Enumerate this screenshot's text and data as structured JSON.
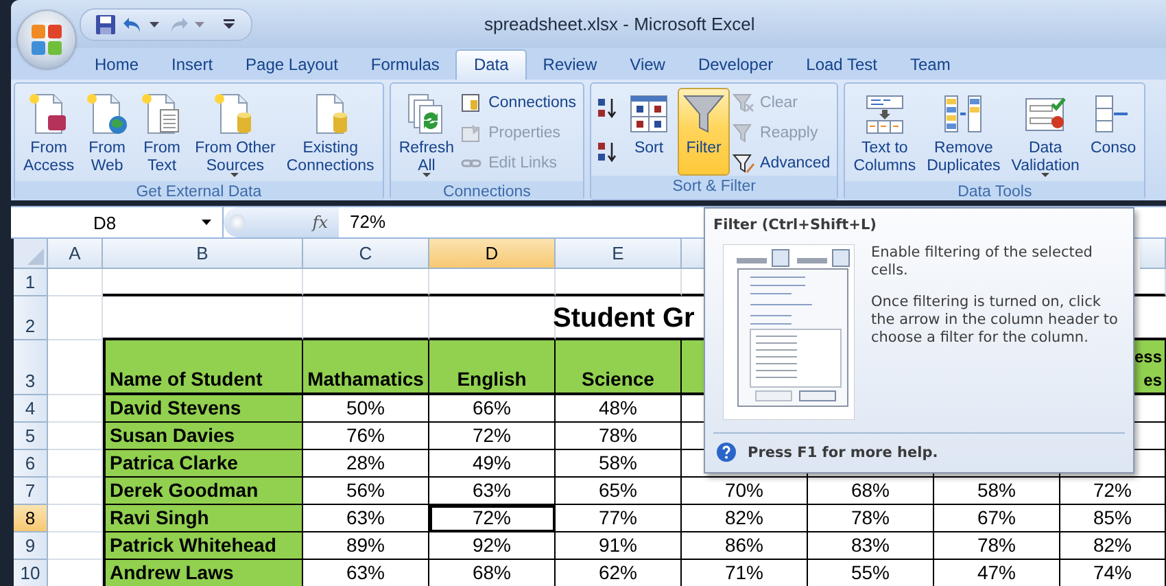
{
  "window": {
    "title": "spreadsheet.xlsx - Microsoft Excel"
  },
  "tabs": [
    {
      "label": "Home",
      "selected": false
    },
    {
      "label": "Insert",
      "selected": false
    },
    {
      "label": "Page Layout",
      "selected": false
    },
    {
      "label": "Formulas",
      "selected": false
    },
    {
      "label": "Data",
      "selected": true
    },
    {
      "label": "Review",
      "selected": false
    },
    {
      "label": "View",
      "selected": false
    },
    {
      "label": "Developer",
      "selected": false
    },
    {
      "label": "Load Test",
      "selected": false
    },
    {
      "label": "Team",
      "selected": false
    }
  ],
  "ribbon": {
    "groups": [
      {
        "label": "Get External Data",
        "buttons": [
          {
            "kind": "large",
            "label": "From\nAccess",
            "dropdown": false,
            "active": false
          },
          {
            "kind": "large",
            "label": "From\nWeb",
            "dropdown": false,
            "active": false
          },
          {
            "kind": "large",
            "label": "From\nText",
            "dropdown": false,
            "active": false
          },
          {
            "kind": "large",
            "label": "From Other\nSources",
            "dropdown": true,
            "active": false
          },
          {
            "kind": "large",
            "label": "Existing\nConnections",
            "dropdown": false,
            "active": false
          }
        ]
      },
      {
        "label": "Connections",
        "buttons": [
          {
            "kind": "large",
            "label": "Refresh\nAll",
            "dropdown": true,
            "active": false
          },
          {
            "kind": "small",
            "label": "Connections",
            "disabled": false
          },
          {
            "kind": "small",
            "label": "Properties",
            "disabled": true
          },
          {
            "kind": "small",
            "label": "Edit Links",
            "disabled": true
          }
        ]
      },
      {
        "label": "Sort & Filter",
        "buttons": [
          {
            "kind": "icon"
          },
          {
            "kind": "icon"
          },
          {
            "kind": "large",
            "label": "Sort",
            "dropdown": false,
            "active": false
          },
          {
            "kind": "large",
            "label": "Filter",
            "dropdown": false,
            "active": true
          },
          {
            "kind": "small",
            "label": "Clear",
            "disabled": true
          },
          {
            "kind": "small",
            "label": "Reapply",
            "disabled": true
          },
          {
            "kind": "small",
            "label": "Advanced",
            "disabled": false
          }
        ]
      },
      {
        "label": "Data Tools",
        "buttons": [
          {
            "kind": "large",
            "label": "Text to\nColumns",
            "dropdown": false,
            "active": false
          },
          {
            "kind": "large",
            "label": "Remove\nDuplicates",
            "dropdown": false,
            "active": false
          },
          {
            "kind": "large",
            "label": "Data\nValidation",
            "dropdown": true,
            "active": false
          },
          {
            "kind": "large",
            "label": "Conso",
            "dropdown": false,
            "active": false
          }
        ]
      }
    ]
  },
  "formula_bar": {
    "name_box": "D8",
    "function_label": "fx",
    "value": "72%"
  },
  "sheet": {
    "columns": [
      {
        "label": "A",
        "selected": false
      },
      {
        "label": "B",
        "selected": false
      },
      {
        "label": "C",
        "selected": false
      },
      {
        "label": "D",
        "selected": true
      },
      {
        "label": "E",
        "selected": false
      },
      {
        "selected": false
      }
    ],
    "rows": [
      {
        "number": "1",
        "selected": false,
        "kind": "blank"
      },
      {
        "number": "2",
        "selected": false,
        "kind": "title",
        "title": "Student Gr"
      },
      {
        "number": "3",
        "selected": false,
        "kind": "header",
        "cells": [
          null,
          "Name of Student",
          "Mathamatics",
          "English",
          "Science",
          null,
          null,
          null,
          "ess\nes"
        ]
      },
      {
        "number": "4",
        "selected": false,
        "kind": "student",
        "cells": [
          null,
          "David Stevens",
          "50%",
          "66%",
          "48%",
          null,
          null,
          null,
          null
        ]
      },
      {
        "number": "5",
        "selected": false,
        "kind": "student",
        "cells": [
          null,
          "Susan Davies",
          "76%",
          "72%",
          "78%",
          null,
          null,
          null,
          null
        ]
      },
      {
        "number": "6",
        "selected": false,
        "kind": "student",
        "cells": [
          null,
          "Patrica Clarke",
          "28%",
          "49%",
          "58%",
          null,
          null,
          null,
          null
        ]
      },
      {
        "number": "7",
        "selected": false,
        "kind": "student",
        "cells": [
          null,
          "Derek Goodman",
          "56%",
          "63%",
          "65%",
          "70%",
          "68%",
          "58%",
          "72%"
        ]
      },
      {
        "number": "8",
        "selected": true,
        "kind": "student",
        "cells": [
          null,
          "Ravi Singh",
          "63%",
          "72%",
          "77%",
          "82%",
          "78%",
          "67%",
          "85%"
        ]
      },
      {
        "number": "9",
        "selected": false,
        "kind": "student",
        "cells": [
          null,
          "Patrick Whitehead",
          "89%",
          "92%",
          "91%",
          "86%",
          "83%",
          "78%",
          "82%"
        ]
      },
      {
        "number": "10",
        "selected": false,
        "kind": "student",
        "cells": [
          null,
          "Andrew Laws",
          "63%",
          "68%",
          "62%",
          "71%",
          "55%",
          "47%",
          "74%"
        ]
      }
    ]
  },
  "tooltip": {
    "title": "Filter (Ctrl+Shift+L)",
    "paragraphs": [
      "Enable filtering of the selected cells.",
      "Once filtering is turned on, click the arrow in the column header to choose a filter for the column."
    ],
    "help": "Press F1 for more help."
  }
}
